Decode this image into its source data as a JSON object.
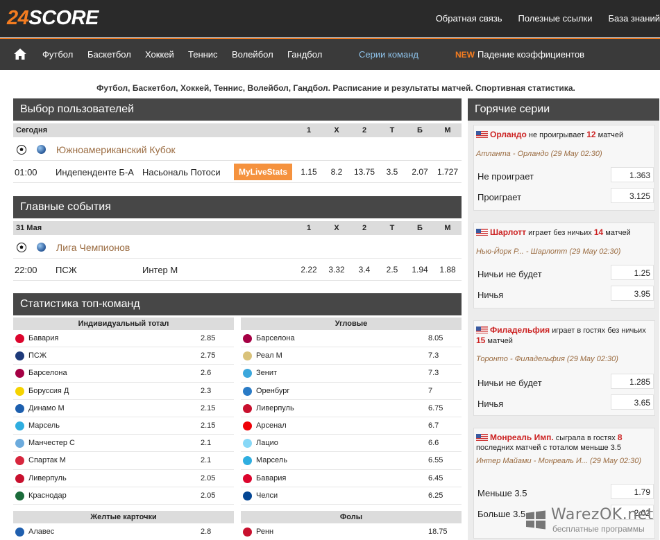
{
  "header": {
    "logo_num": "24",
    "logo_word": "SCORE",
    "links": [
      "Обратная связь",
      "Полезные ссылки",
      "База знаний"
    ]
  },
  "nav": {
    "items": [
      "Футбол",
      "Баскетбол",
      "Хоккей",
      "Теннис",
      "Волейбол",
      "Гандбол"
    ],
    "series": "Серии команд",
    "new_badge": "NEW",
    "odds_drop": "Падение коэффициентов"
  },
  "tagline": "Футбол, Баскетбол, Хоккей, Теннис, Волейбол, Гандбол. Расписание и результаты матчей. Спортивная статистика.",
  "user_choice": {
    "title": "Выбор пользователей",
    "date": "Сегодня",
    "cols": [
      "1",
      "X",
      "2",
      "Т",
      "Б",
      "М"
    ],
    "league": "Южноамериканский Кубок",
    "match": {
      "time": "01:00",
      "home": "Индепенденте Б-А",
      "away": "Насьональ Потоси",
      "badge": "MyLiveStats",
      "odds": [
        "1.15",
        "8.2",
        "13.75",
        "3.5",
        "2.07",
        "1.727"
      ]
    }
  },
  "main_events": {
    "title": "Главные события",
    "date": "31 Мая",
    "cols": [
      "1",
      "X",
      "2",
      "Т",
      "Б",
      "М"
    ],
    "league": "Лига Чемпионов",
    "match": {
      "time": "22:00",
      "home": "ПСЖ",
      "away": "Интер М",
      "odds": [
        "2.22",
        "3.32",
        "3.4",
        "2.5",
        "1.94",
        "1.88"
      ]
    }
  },
  "top_stats": {
    "title": "Статистика топ-команд",
    "individual_total": {
      "label": "Индивидуальный тотал",
      "rows": [
        {
          "team": "Бавария",
          "value": "2.85",
          "color": "#dc052d"
        },
        {
          "team": "ПСЖ",
          "value": "2.75",
          "color": "#1e3a7a"
        },
        {
          "team": "Барселона",
          "value": "2.6",
          "color": "#a50044"
        },
        {
          "team": "Боруссия Д",
          "value": "2.3",
          "color": "#f5d300"
        },
        {
          "team": "Динамо М",
          "value": "2.15",
          "color": "#1d5fae"
        },
        {
          "team": "Марсель",
          "value": "2.15",
          "color": "#2faee0"
        },
        {
          "team": "Манчестер С",
          "value": "2.1",
          "color": "#6cabdd"
        },
        {
          "team": "Спартак М",
          "value": "2.1",
          "color": "#d7263d"
        },
        {
          "team": "Ливерпуль",
          "value": "2.05",
          "color": "#c8102e"
        },
        {
          "team": "Краснодар",
          "value": "2.05",
          "color": "#1a6b3a"
        }
      ]
    },
    "corners": {
      "label": "Угловые",
      "rows": [
        {
          "team": "Барселона",
          "value": "8.05",
          "color": "#a50044"
        },
        {
          "team": "Реал М",
          "value": "7.3",
          "color": "#d9c27a"
        },
        {
          "team": "Зенит",
          "value": "7.3",
          "color": "#3ba7dc"
        },
        {
          "team": "Оренбург",
          "value": "7",
          "color": "#2a7bc6"
        },
        {
          "team": "Ливерпуль",
          "value": "6.75",
          "color": "#c8102e"
        },
        {
          "team": "Арсенал",
          "value": "6.7",
          "color": "#ef0107"
        },
        {
          "team": "Лацио",
          "value": "6.6",
          "color": "#87d8f7"
        },
        {
          "team": "Марсель",
          "value": "6.55",
          "color": "#2faee0"
        },
        {
          "team": "Бавария",
          "value": "6.45",
          "color": "#dc052d"
        },
        {
          "team": "Челси",
          "value": "6.25",
          "color": "#034694"
        }
      ]
    },
    "yellow_cards": {
      "label": "Желтые карточки",
      "rows": [
        {
          "team": "Алавес",
          "value": "2.8",
          "color": "#1f5fae"
        }
      ]
    },
    "fouls": {
      "label": "Фолы",
      "rows": [
        {
          "team": "Ренн",
          "value": "18.75",
          "color": "#c8102e"
        }
      ]
    }
  },
  "hot_series": {
    "title": "Горячие серии",
    "cards": [
      {
        "team": "Орландо",
        "text1": " не проигрывает ",
        "num": "12",
        "text2": " матчей",
        "match": "Атланта - Орландо (29 May 02:30)",
        "bets": [
          {
            "label": "Не проиграет",
            "odd": "1.363"
          },
          {
            "label": "Проиграет",
            "odd": "3.125"
          }
        ]
      },
      {
        "team": "Шарлотт",
        "text1": " играет без ничьих ",
        "num": "14",
        "text2": " матчей",
        "match": "Нью-Йорк Р... - Шарлотт (29 May 02:30)",
        "bets": [
          {
            "label": "Ничьи не будет",
            "odd": "1.25"
          },
          {
            "label": "Ничья",
            "odd": "3.95"
          }
        ]
      },
      {
        "team": "Филадельфия",
        "text1": " играет в гостях без ничьих ",
        "num": "15",
        "text2": " матчей",
        "match": "Торонто - Филадельфия (29 May 02:30)",
        "bets": [
          {
            "label": "Ничьи не будет",
            "odd": "1.285"
          },
          {
            "label": "Ничья",
            "odd": "3.65"
          }
        ]
      },
      {
        "team": "Монреаль Имп.",
        "text1": " сыграла в гостях ",
        "num": "8",
        "text2": " последних матчей с тоталом меньше 3.5",
        "match": "Интер Майами - Монреаль И... (29 May 02:30)",
        "bets": [
          {
            "label": "Меньше 3.5",
            "odd": "1.79"
          },
          {
            "label": "Больше 3.5",
            "odd": "2.02"
          }
        ]
      }
    ]
  },
  "watermark": {
    "brand": "WarezOK.net",
    "sub": "бесплатные программы"
  }
}
